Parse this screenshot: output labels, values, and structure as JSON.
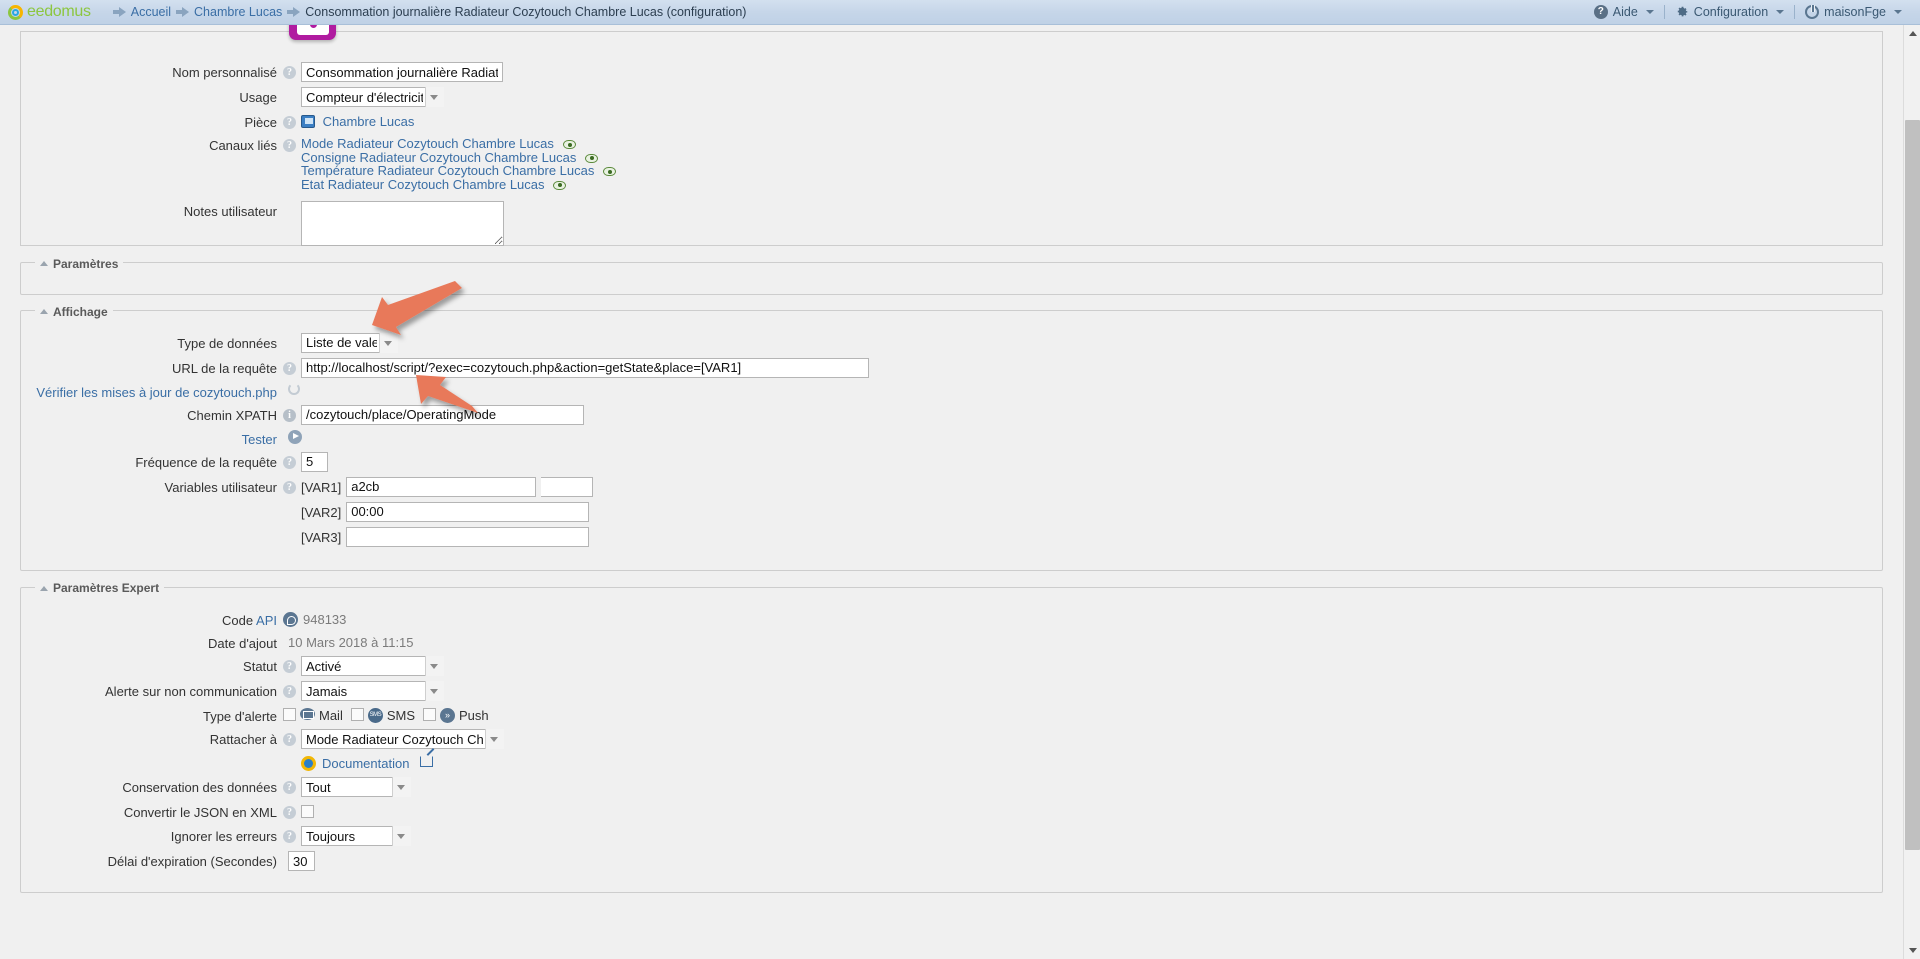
{
  "topbar": {
    "logo_text": "eedomus",
    "breadcrumbs": [
      {
        "label": "Accueil",
        "icon": "arrow-right-icon"
      },
      {
        "label": "Chambre Lucas",
        "icon": "arrow-right-icon"
      },
      {
        "label": "Consommation journalière Radiateur Cozytouch Chambre Lucas (configuration)",
        "icon": "arrow-right-icon"
      }
    ],
    "right": [
      {
        "label": "Aide",
        "icon": "help-icon"
      },
      {
        "label": "Configuration",
        "icon": "gear-icon"
      },
      {
        "label": "maisonFge",
        "icon": "power-icon"
      }
    ]
  },
  "main_panel": {
    "nom_personnalise": {
      "label": "Nom personnalisé",
      "value": "Consommation journalière Radiateur Cozytouch Chambre Lucas"
    },
    "usage": {
      "label": "Usage",
      "value": "Compteur d'électricité"
    },
    "piece": {
      "label": "Pièce",
      "value": "Chambre Lucas"
    },
    "canaux_lies": {
      "label": "Canaux liés",
      "items": [
        "Mode Radiateur Cozytouch Chambre Lucas",
        "Consigne Radiateur Cozytouch Chambre Lucas",
        "Température Radiateur Cozytouch Chambre Lucas",
        "Etat Radiateur Cozytouch Chambre Lucas"
      ]
    },
    "notes_utilisateur": {
      "label": "Notes utilisateur",
      "value": ""
    }
  },
  "parametres": {
    "legend": "Paramètres"
  },
  "affichage": {
    "legend": "Affichage",
    "type_de_donnees": {
      "label": "Type de données",
      "value": "Liste de valeurs"
    },
    "url_requete": {
      "label": "URL de la requête",
      "value": "http://localhost/script/?exec=cozytouch.php&action=getState&place=[VAR1]"
    },
    "verifier_maj": {
      "label": "Vérifier les mises à jour de cozytouch.php"
    },
    "chemin_xpath": {
      "label": "Chemin XPATH",
      "value": "/cozytouch/place/OperatingMode"
    },
    "tester": {
      "label": "Tester"
    },
    "frequence": {
      "label": "Fréquence de la requête",
      "value": "5"
    },
    "variables_utilisateur": {
      "label": "Variables utilisateur",
      "vars": [
        {
          "name": "[VAR1]",
          "value": "a2cb"
        },
        {
          "name": "[VAR2]",
          "value": "00:00"
        },
        {
          "name": "[VAR3]",
          "value": ""
        }
      ]
    }
  },
  "parametres_expert": {
    "legend": "Paramètres Expert",
    "code_api": {
      "label": "Code",
      "link_label": "API",
      "value": "948133"
    },
    "date_ajout": {
      "label": "Date d'ajout",
      "value": "10 Mars 2018 à 11:15"
    },
    "statut": {
      "label": "Statut",
      "value": "Activé"
    },
    "alerte_non_communication": {
      "label": "Alerte sur non communication",
      "value": "Jamais"
    },
    "type_alerte": {
      "label": "Type d'alerte",
      "options": [
        {
          "label": "Mail",
          "icon": "mail-icon",
          "checked": false
        },
        {
          "label": "SMS",
          "icon": "sms-icon",
          "checked": false
        },
        {
          "label": "Push",
          "icon": "push-icon",
          "checked": false
        }
      ]
    },
    "rattacher_a": {
      "label": "Rattacher à",
      "value": "Mode Radiateur Cozytouch Chambre Lucas"
    },
    "documentation": {
      "label": "Documentation"
    },
    "conservation_donnees": {
      "label": "Conservation des données",
      "value": "Tout"
    },
    "convertir_json_xml": {
      "label": "Convertir le JSON en XML",
      "checked": false
    },
    "ignorer_erreurs": {
      "label": "Ignorer les erreurs",
      "value": "Toujours"
    },
    "delai_expiration": {
      "label": "Délai d'expiration (Secondes)",
      "value": "30"
    }
  },
  "colors": {
    "accent_orange": "#e8795a",
    "brand_green": "#8cc63f",
    "link_blue": "#3a6ea5",
    "badge_purple": "#b01ba0"
  }
}
